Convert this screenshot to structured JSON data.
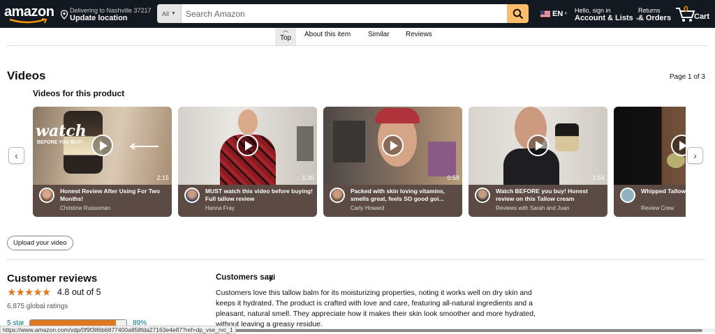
{
  "nav": {
    "logo": "amazon",
    "deliver_line1": "Delivering to Nashville 37217",
    "deliver_line2": "Update location",
    "search_category": "All",
    "search_placeholder": "Search Amazon",
    "language": "EN",
    "account_line1": "Hello, sign in",
    "account_line2": "Account & Lists",
    "returns_line1": "Returns",
    "returns_line2": "& Orders",
    "cart_count": "0",
    "cart_label": "Cart"
  },
  "subtabs": {
    "top": "Top",
    "about": "About this item",
    "similar": "Similar",
    "reviews": "Reviews"
  },
  "videos": {
    "title": "Videos",
    "page_indicator": "Page 1 of 3",
    "subtitle": "Videos for this product",
    "upload_label": "Upload your video",
    "items": [
      {
        "title": "Honest Review After Using For Two Months!",
        "author": "Christine Russoman",
        "duration": "2:15",
        "overlay": "watch",
        "overlay2": "BEFORE YOU BUY!"
      },
      {
        "title": "MUST watch this video before buying! Full tallow review",
        "author": "Hanna Fray",
        "duration": "1:30"
      },
      {
        "title": "Packed with skin loving vitamins, smells great, feels SO good goi...",
        "author": "Carly Howard",
        "duration": "0:58"
      },
      {
        "title": "Watch BEFORE you buy! Honest review on this Tallow cream",
        "author": "Reviews with Sarah and Juan",
        "duration": "1:54"
      },
      {
        "title": "Whipped Tallow Thoughts After",
        "author": "Review Crew",
        "duration": ""
      }
    ]
  },
  "reviews": {
    "title": "Customer reviews",
    "stars": "★★★★★",
    "rating_text": "4.8 out of 5",
    "global_ratings": "6,875 global ratings",
    "five_star_label": "5 star",
    "five_star_pct": "89%",
    "five_star_fraction": 0.89
  },
  "customers_say": {
    "title": "Customers say",
    "ai_badge": "ai",
    "text": "Customers love this tallow balm for its moisturizing properties, noting it works well on dry skin and keeps it hydrated. The product is crafted with love and care, featuring all-natural ingredients and a pleasant, natural smell. They appreciate how it makes their skin look smoother and more hydrated, without leaving a greasy residue."
  },
  "status_url": "https://www.amazon.com/vdp/0f9f386b6877400a858fda27163e4e87?ref=dp_vse_rvc_1",
  "colors": {
    "nav_bg": "#131921",
    "search_button": "#febd69",
    "star": "#de7921",
    "link": "#007185"
  }
}
